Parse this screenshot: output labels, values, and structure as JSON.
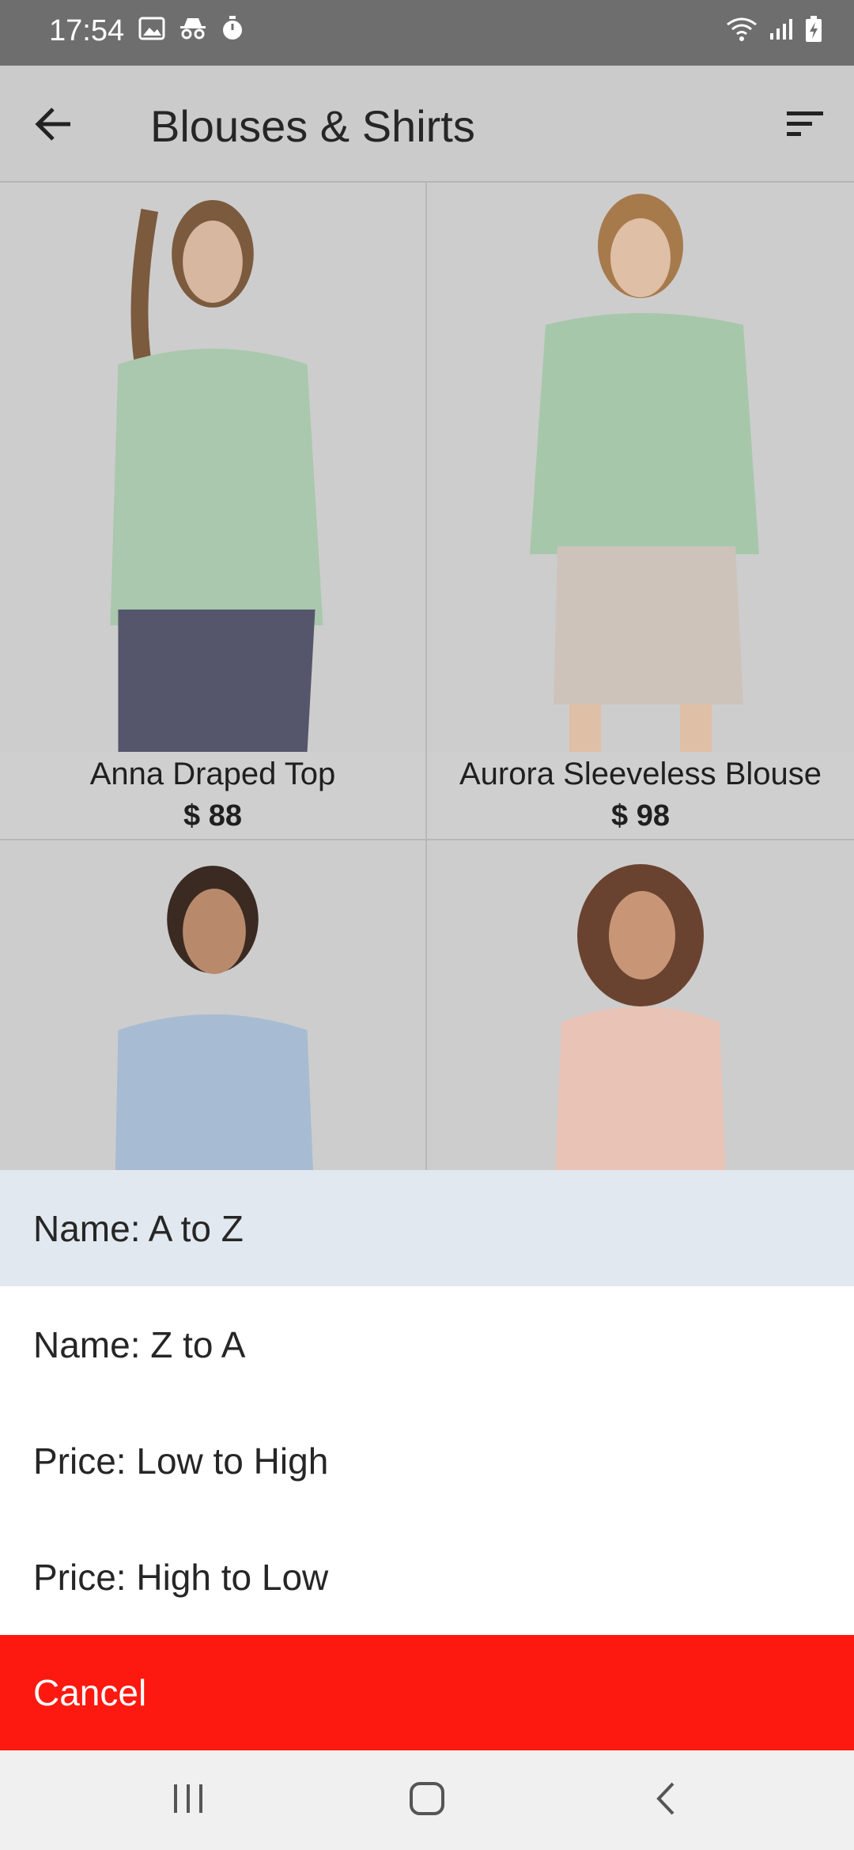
{
  "status_bar": {
    "time": "17:54",
    "left_icons": [
      "image-icon",
      "incognito-icon",
      "timer-icon"
    ],
    "right_icons": [
      "wifi-icon",
      "signal-icon",
      "battery-charging-icon"
    ]
  },
  "app_bar": {
    "title": "Blouses & Shirts",
    "back_icon": "arrow-left-icon",
    "sort_icon": "sort-icon"
  },
  "products": [
    {
      "name": "Anna Draped Top",
      "price": "$ 88",
      "top_color": "#a9c8ad",
      "bottom_color": "#55566b"
    },
    {
      "name": "Aurora Sleeveless Blouse",
      "price": "$ 98",
      "top_color": "#a7c7ab",
      "bottom_color": "#cdc3bb"
    },
    {
      "name": "",
      "price": "",
      "top_color": "#a7bcd2",
      "bottom_color": "#a7bcd2"
    },
    {
      "name": "",
      "price": "",
      "top_color": "#e8c3b6",
      "bottom_color": "#e8c3b6"
    }
  ],
  "sort_sheet": {
    "options": [
      {
        "label": "Name: A to Z",
        "selected": true
      },
      {
        "label": "Name: Z to A",
        "selected": false
      },
      {
        "label": "Price: Low to High",
        "selected": false
      },
      {
        "label": "Price: High to Low",
        "selected": false
      }
    ],
    "cancel_label": "Cancel",
    "cancel_color": "#fe1910"
  },
  "nav_bar": {
    "buttons": [
      "recent-apps-icon",
      "home-icon",
      "back-icon"
    ]
  }
}
